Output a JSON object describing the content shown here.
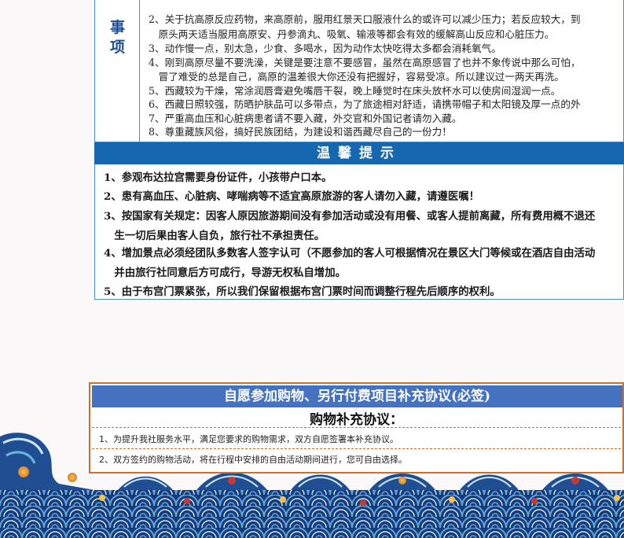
{
  "notes": {
    "label_chars": [
      "事",
      "项"
    ],
    "lines": [
      "2、关于抗高原反应药物，来高原前，服用红景天口服液什么的或许可以减少压力；若反应较大，到",
      "　原头两天适当服用高原安、丹参滴丸、吸氧、输液等都会有效的缓解高山反应和心脏压力。",
      "3、动作慢一点，别太急，少食、多喝水，因为动作太快吃得太多都会消耗氧气。",
      "4、刚到高原尽量不要洗澡，关键是要注意不要感冒，虽然在高原感冒了也并不象传说中那么可怕，",
      "　冒了难受的总是自己，高原的温差很大你还没有把握好，容易受凉。所以建议过一两天再洗。",
      "5、西藏较为干燥，常涂润唇膏避免嘴唇干裂，晚上睡觉时在床头放杯水可以使房间湿润一点。",
      "6、西藏日照较强，防晒护肤品可以多带点，为了旅途相对舒适，请携带帽子和太阳镜及厚一点的外",
      "7、严重高血压和心脏病患者请不要入藏，外交官和外国记者请勿入藏。",
      "8、尊重藏族风俗，搞好民族团结，为建设和谐西藏尽自己的一份力！"
    ]
  },
  "tips": {
    "title": "温馨提示",
    "lines": [
      "1、参观布达拉宫需要身份证件，小孩带户口本。",
      "2、患有高血压、心脏病、哮喘病等不适宜高原旅游的客人请勿入藏，请遵医嘱！",
      "3、按国家有关规定：因客人原因旅游期间没有参加活动或没有用餐、或客人提前离藏，所有费用概不退还",
      "　生一切后果由客人自负，旅行社不承担责任。",
      "4、增加景点必须经团队多数客人签字认可（不愿参加的客人可根据情况在景区大门等候或在酒店自由活动",
      "　并由旅行社同意后方可成行，导游无权私自增加。",
      "5、由于布宫门票紧张，所以我们保留根据布宫门票时间而调整行程先后顺序的权利。"
    ]
  },
  "agreement": {
    "title": "自愿参加购物、另行付费项目补充协议(必签)",
    "subtitle": "购物补充协议：",
    "items": [
      "1、为提升我社服务水平，满足您要求的购物需求，双方自愿签署本补充协议。",
      "2、双方签约的购物活动，将在行程中安排的自由活动期间进行，您可自由选择。"
    ]
  },
  "colors": {
    "table_border": "#4a8fc9",
    "tips_header": "#1567b0",
    "agreement_header": "#4471c0",
    "agreement_border": "#c8702c",
    "label_text": "#1d4f96"
  }
}
